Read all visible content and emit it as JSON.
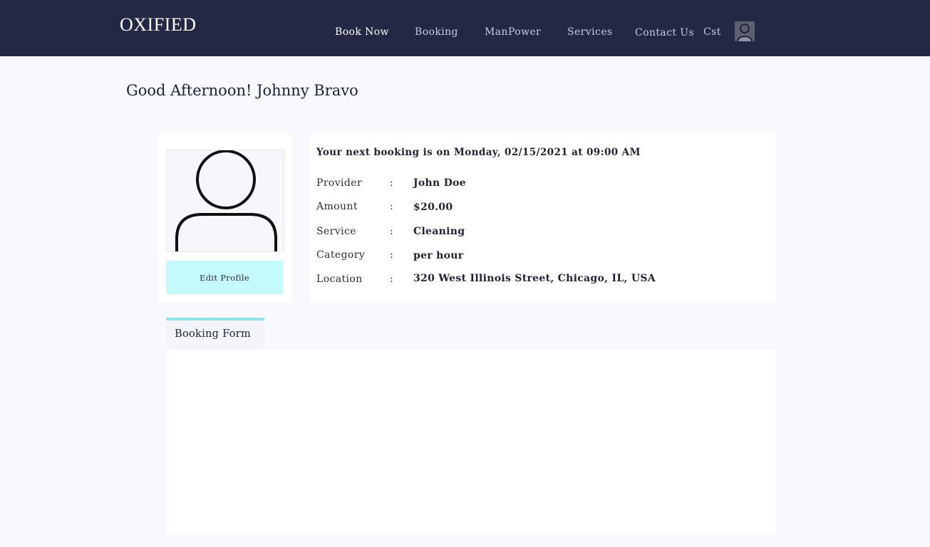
{
  "header": {
    "logo": "OXIFIED",
    "nav": [
      {
        "label": "Book Now"
      },
      {
        "label": "Booking"
      },
      {
        "label": "ManPower"
      },
      {
        "label": "Services"
      },
      {
        "label": "Contact Us"
      },
      {
        "label": "Cst"
      }
    ],
    "avatar_icon": "user-avatar-icon"
  },
  "greeting": "Good Afternoon! Johnny Bravo",
  "profile": {
    "avatar_icon": "user-silhouette-icon",
    "edit_label": "Edit Profile"
  },
  "booking": {
    "headline": "Your next booking is on Monday, 02/15/2021 at 09:00 AM",
    "details": [
      {
        "label": "Provider",
        "value": "John Doe"
      },
      {
        "label": "Amount",
        "value": "$20.00"
      },
      {
        "label": "Service",
        "value": "Cleaning"
      },
      {
        "label": "Category",
        "value": "per hour"
      },
      {
        "label": "Location",
        "value": "320 West Illinois Street, Chicago, IL, USA"
      }
    ],
    "separator": ":"
  },
  "tabs": [
    {
      "label": "Booking Form",
      "active": true
    }
  ],
  "colors": {
    "header_bg": "#232845",
    "accent": "#8ee6ec",
    "button_bg": "#c5fafb",
    "page_bg": "#f8f9fd"
  }
}
